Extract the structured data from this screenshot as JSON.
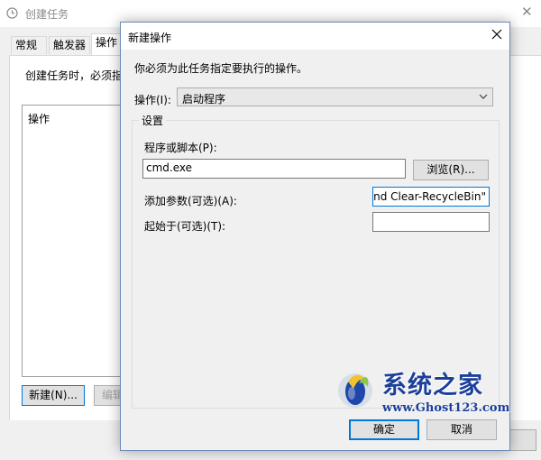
{
  "background_window": {
    "title": "创建任务",
    "tabs": [
      "常规",
      "触发器",
      "操作"
    ],
    "hint": "创建任务时，必须指定",
    "list_header": "操作",
    "new_button": "新建(N)...",
    "edit_button": "编辑"
  },
  "dialog": {
    "title": "新建操作",
    "instruction": "你必须为此任务指定要执行的操作。",
    "action_label": "操作(I):",
    "action_value": "启动程序",
    "settings_label": "设置",
    "program_label": "程序或脚本(P):",
    "program_value": "cmd.exe",
    "browse_label": "浏览(R)...",
    "args_label": "添加参数(可选)(A):",
    "args_value": "mand Clear-RecycleBin\"",
    "startin_label": "起始于(可选)(T):",
    "startin_value": "",
    "ok_label": "确定",
    "cancel_label": "取消"
  },
  "watermark": {
    "name": "系统之家",
    "url": "www.Ghost123.com"
  },
  "colors": {
    "accent": "#0078d7",
    "watermark": "#1b3f9a"
  }
}
